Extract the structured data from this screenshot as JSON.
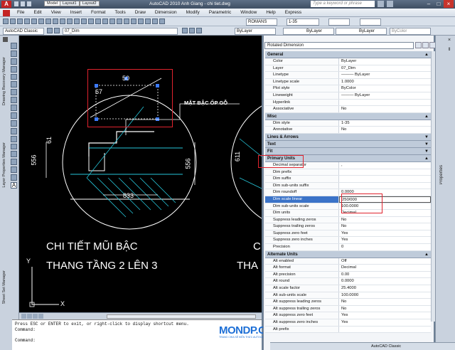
{
  "titlebar": {
    "title": "AutoCAD 2010      Anh Giang - chi tiet.dwg",
    "search_placeholder": "Type a keyword or phrase"
  },
  "menubar": {
    "items": [
      "File",
      "Edit",
      "View",
      "Insert",
      "Format",
      "Tools",
      "Draw",
      "Dimension",
      "Modify",
      "Parametric",
      "Window",
      "Help",
      "Express"
    ]
  },
  "toolbar1": {
    "textstyle": "ROMANS",
    "dimstyle": "1-35"
  },
  "toolbar2": {
    "workspace": "AutoCAD Classic",
    "layer": "07_Dim",
    "color": "ByLayer",
    "linetype": "ByLayer",
    "lineweight": "ByLayer",
    "plotstyle": "ByColor"
  },
  "left_strip": {
    "labels": [
      "Drawing Recovery Manager",
      "Layer Properties Manager",
      "Sheet Set Manager"
    ]
  },
  "drawing": {
    "annotation_label": "MẶT BẬC ỐP GỖ",
    "title_line1": "CHI TIẾT MŨI BẬC",
    "title_line2": "THANG TẦNG 2 LÊN 3",
    "title_right_1": "C",
    "title_right_2": "THA",
    "dim_556_left": "556",
    "dim_556_right": "556",
    "dim_611": "611",
    "dim_833": "833",
    "dim_67": "67",
    "dim_50": "50",
    "dim_61": "61",
    "axis_y": "Y",
    "axis_x": "X"
  },
  "tabs": [
    "Model",
    "Layout1",
    "Layout2"
  ],
  "cmdline": {
    "lines": [
      "Press ESC or ENTER to exit, or right-click to display shortcut menu.",
      "Command:",
      "",
      "Command:"
    ]
  },
  "properties": {
    "selector": "Rotated Dimension",
    "side_label": "Properties",
    "categories": [
      {
        "name": "General",
        "collapse": "▲",
        "rows": [
          {
            "k": "Color",
            "v": "ByLayer"
          },
          {
            "k": "Layer",
            "v": "07_Dim"
          },
          {
            "k": "Linetype",
            "v": "——— ByLayer"
          },
          {
            "k": "Linetype scale",
            "v": "1.0000"
          },
          {
            "k": "Plot style",
            "v": "ByColor"
          },
          {
            "k": "Lineweight",
            "v": "——— ByLayer"
          },
          {
            "k": "Hyperlink",
            "v": ""
          },
          {
            "k": "Associative",
            "v": "No"
          }
        ]
      },
      {
        "name": "Misc",
        "collapse": "▲",
        "rows": [
          {
            "k": "Dim style",
            "v": "1-35"
          },
          {
            "k": "Annotative",
            "v": "No"
          }
        ]
      },
      {
        "name": "Lines & Arrows",
        "collapse": "▼",
        "rows": []
      },
      {
        "name": "Text",
        "collapse": "▼",
        "rows": []
      },
      {
        "name": "Fit",
        "collapse": "▼",
        "rows": []
      },
      {
        "name": "Primary Units",
        "collapse": "▲",
        "rows": [
          {
            "k": "Decimal separator",
            "v": ","
          },
          {
            "k": "Dim prefix",
            "v": ""
          },
          {
            "k": "Dim suffix",
            "v": ""
          },
          {
            "k": "Dim sub-units suffix",
            "v": ""
          },
          {
            "k": "Dim roundoff",
            "v": "0.0000"
          },
          {
            "k": "Dim scale linear",
            "v": "250/000",
            "selected": true
          },
          {
            "k": "Dim sub-units scale",
            "v": "100.0000"
          },
          {
            "k": "Dim units",
            "v": "Decimal"
          },
          {
            "k": "Suppress leading zeros",
            "v": "No"
          },
          {
            "k": "Suppress trailing zeros",
            "v": "No"
          },
          {
            "k": "Suppress zero feet",
            "v": "Yes"
          },
          {
            "k": "Suppress zero inches",
            "v": "Yes"
          },
          {
            "k": "Precision",
            "v": "0"
          }
        ]
      },
      {
        "name": "Alternate Units",
        "collapse": "▲",
        "rows": [
          {
            "k": "Alt enabled",
            "v": "Off"
          },
          {
            "k": "Alt format",
            "v": "Decimal"
          },
          {
            "k": "Alt precision",
            "v": "0.00"
          },
          {
            "k": "Alt round",
            "v": "0.0000"
          },
          {
            "k": "Alt scale factor",
            "v": "25.4000"
          },
          {
            "k": "Alt sub-units scale",
            "v": "100.0000"
          },
          {
            "k": "Alt suppress leading zeros",
            "v": "No"
          },
          {
            "k": "Alt suppress trailing zeros",
            "v": "No"
          },
          {
            "k": "Alt suppress zero feet",
            "v": "Yes"
          },
          {
            "k": "Alt suppress zero inches",
            "v": "Yes"
          },
          {
            "k": "Alt prefix",
            "v": ""
          }
        ]
      }
    ]
  },
  "status_bar": {
    "workspace": "AutoCAD Classic"
  },
  "watermark": {
    "logo": "MONDP.COM",
    "sub": "TRANG CHIA SẺ KIẾN THỨC AUTOCAD MIỄN PHÍ"
  },
  "colors": {
    "accent": "#3b73c8",
    "highlight": "#e0232e",
    "canvas": "#000000"
  }
}
